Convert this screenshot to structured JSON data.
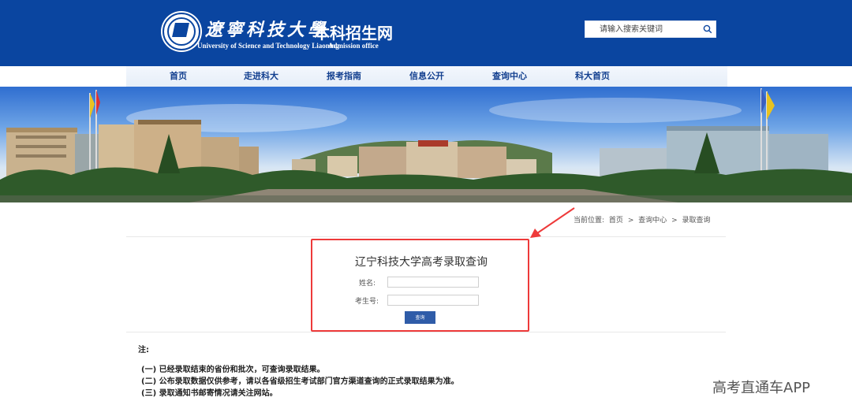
{
  "header": {
    "university_cn": "遼寧科技大學",
    "university_en": "University of Science and Technology Liaoning",
    "site_cn": "本科招生网",
    "site_en": "Admission office",
    "search_placeholder": "请输入搜索关键词"
  },
  "nav": {
    "items": [
      "首页",
      "走进科大",
      "报考指南",
      "信息公开",
      "查询中心",
      "科大首页"
    ]
  },
  "breadcrumb": {
    "prefix": "当前位置:",
    "home": "首页",
    "sep": ">",
    "center": "查询中心",
    "current": "录取查询"
  },
  "form": {
    "title": "辽宁科技大学高考录取查询",
    "name_label": "姓名:",
    "id_label": "考生号:",
    "query_button": "查询",
    "name_value": "",
    "id_value": ""
  },
  "notes": {
    "heading": "注:",
    "items": [
      "(一) 已经录取结束的省份和批次，可查询录取结果。",
      "(二) 公布录取数据仅供参考，请以各省级招生考试部门官方渠道查询的正式录取结果为准。",
      "(三) 录取通知书邮寄情况请关注网站。"
    ]
  },
  "watermark": "高考直通车APP",
  "colors": {
    "header_blue": "#0a45a0",
    "nav_text": "#123f8f",
    "button_blue": "#2f5ca8",
    "annotation_red": "#ee3a3a"
  }
}
